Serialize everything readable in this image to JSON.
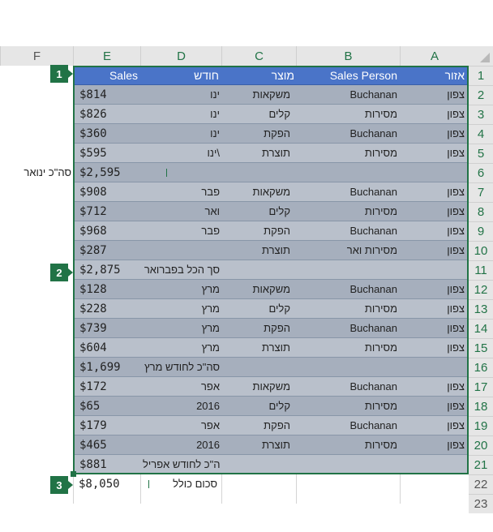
{
  "columns": [
    "A",
    "B",
    "C",
    "D",
    "E",
    "F"
  ],
  "rows": [
    "1",
    "2",
    "3",
    "4",
    "5",
    "6",
    "7",
    "8",
    "9",
    "10",
    "11",
    "12",
    "13",
    "14",
    "15",
    "16",
    "17",
    "18",
    "19",
    "20",
    "21",
    "22",
    "23"
  ],
  "header": {
    "region": "אזור",
    "person": "Sales Person",
    "product": "מוצר",
    "month": "חודש",
    "sales": "Sales"
  },
  "data": [
    {
      "region": "צפון",
      "person": "Buchanan",
      "product": "משקאות",
      "month": "ינו",
      "sales": "$814"
    },
    {
      "region": "צפון",
      "person": "מסירות",
      "product": "קלים",
      "month": "ינו",
      "sales": "$826"
    },
    {
      "region": "צפון",
      "person": "Buchanan",
      "product": "הפקת",
      "month": "ינו",
      "sales": "$360"
    },
    {
      "region": "צפון",
      "person": "מסירות",
      "product": "תוצרת",
      "month": "ינו\\",
      "sales": "$595"
    },
    {
      "region": "",
      "person": "",
      "product": "",
      "month": "",
      "sales": "$2,595"
    },
    {
      "region": "צפון",
      "person": "Buchanan",
      "product": "משקאות",
      "month": "פבר",
      "sales": "$908"
    },
    {
      "region": "צפון",
      "person": "מסירות",
      "product": "קלים",
      "month": "ואר",
      "sales": "$712"
    },
    {
      "region": "צפון",
      "person": "Buchanan",
      "product": "הפקת",
      "month": "פבר",
      "sales": "$968"
    },
    {
      "region": "צפון",
      "person": "מסירות     ואר",
      "product": "תוצרת",
      "month": "",
      "sales": "$287"
    },
    {
      "region": "",
      "person": "",
      "product": "",
      "month": "סך הכל בפברואר",
      "sales": "$2,875"
    },
    {
      "region": "צפון",
      "person": "Buchanan",
      "product": "משקאות",
      "month": "מרץ",
      "sales": "$128"
    },
    {
      "region": "צפון",
      "person": "מסירות",
      "product": "קלים",
      "month": "מרץ",
      "sales": "$228"
    },
    {
      "region": "צפון",
      "person": "Buchanan",
      "product": "הפקת",
      "month": "מרץ",
      "sales": "$739"
    },
    {
      "region": "צפון",
      "person": "מסירות",
      "product": "תוצרת",
      "month": "מרץ",
      "sales": "$604"
    },
    {
      "region": "",
      "person": "",
      "product": "",
      "month": "סה\"כ לחודש מרץ",
      "sales": "$1,699"
    },
    {
      "region": "צפון",
      "person": "Buchanan",
      "product": "משקאות",
      "month": "אפר",
      "sales": "$172"
    },
    {
      "region": "צפון",
      "person": "מסירות",
      "product": "קלים",
      "month": "2016",
      "sales": "$65"
    },
    {
      "region": "צפון",
      "person": "Buchanan",
      "product": "הפקת",
      "month": "אפר",
      "sales": "$179"
    },
    {
      "region": "צפון",
      "person": "מסירות",
      "product": "תוצרת",
      "month": "2016",
      "sales": "$465"
    },
    {
      "region": "",
      "person": "",
      "product": "",
      "month": "סה\"כ לחודש אפריל",
      "sales": "$881"
    }
  ],
  "grand_total": {
    "label": "סכום כולל",
    "value": "$8,050"
  },
  "outside_label_row6": "סה\"כ ינואר",
  "callouts": [
    "1",
    "2",
    "3"
  ],
  "colors": {
    "header_band": "#4a74c8",
    "band_dark": "#a6afbd",
    "band_light": "#b9c0cb",
    "accent": "#217346"
  }
}
